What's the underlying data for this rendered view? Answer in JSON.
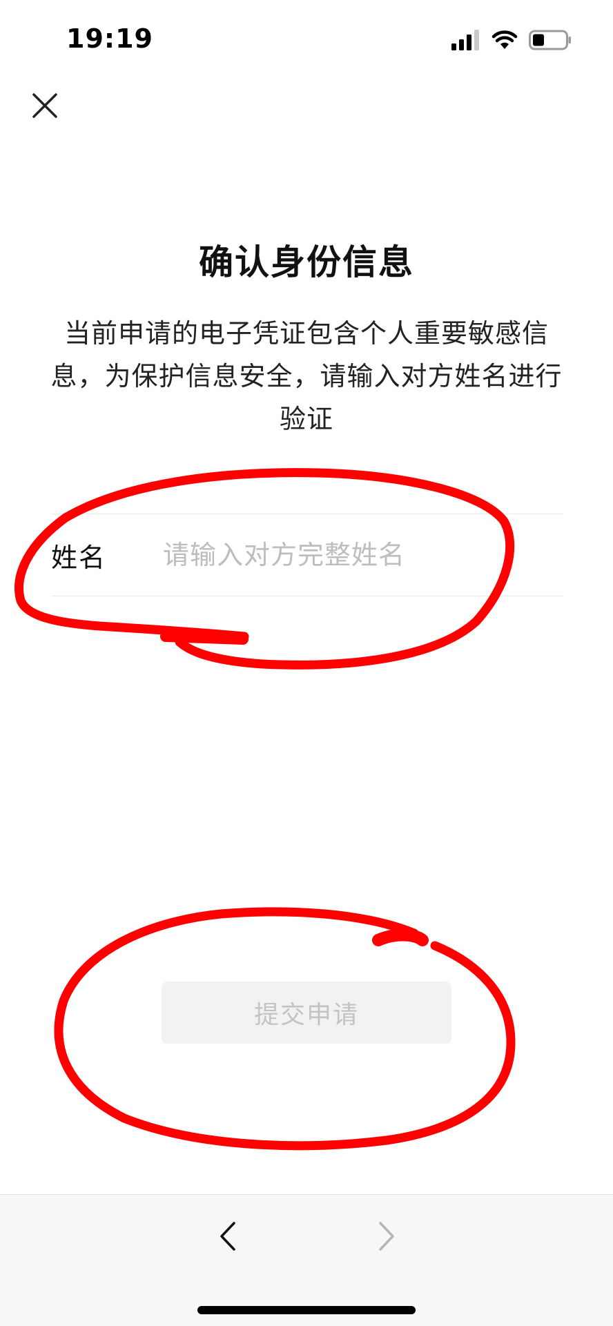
{
  "status_bar": {
    "time": "19:19",
    "icons": [
      "signal-icon",
      "wifi-icon",
      "battery-icon"
    ]
  },
  "header": {
    "close_icon": "close-icon"
  },
  "main": {
    "title": "确认身份信息",
    "description": "当前申请的电子凭证包含个人重要敏感信息，为保护信息安全，请输入对方姓名进行验证",
    "name_field": {
      "label": "姓名",
      "value": "",
      "placeholder": "请输入对方完整姓名"
    },
    "submit_label": "提交申请"
  },
  "bottom_bar": {
    "back_icon": "chevron-left-icon",
    "forward_icon": "chevron-right-icon"
  },
  "colors": {
    "annotation": "#ff0000",
    "submit_bg": "#f2f2f2",
    "submit_text": "#c3c3c3",
    "placeholder": "#bdbdbd"
  }
}
